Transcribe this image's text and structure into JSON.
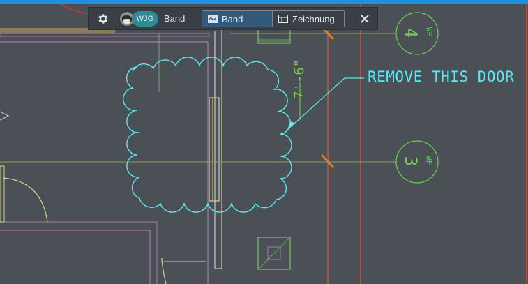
{
  "toolbar": {
    "title": "Band",
    "avatar_initials": "WJG",
    "modes": [
      {
        "label": "Band",
        "active": true
      },
      {
        "label": "Zeichnung",
        "active": false
      }
    ]
  },
  "drawing": {
    "annotation": "REMOVE THIS DOOR",
    "dimension_label": "7'-6\"",
    "grid_bubbles": [
      {
        "number": "4",
        "sub": "WF"
      },
      {
        "number": "3",
        "sub": "WF"
      }
    ]
  },
  "colors": {
    "accent_bar": "#1f8fe0",
    "toolbar_bg": "#3a3f45",
    "canvas_bg": "#4b4f56",
    "markup_cyan": "#5ce8f0",
    "dimension_green": "#7ccf4a",
    "grid_line_orange": "#d85a38",
    "wall_magenta": "#a37aa8",
    "door_yellow": "#d6d38a"
  },
  "icons": {
    "settings": "gear-icon",
    "close": "close-icon",
    "band_mode": "markup-band-icon",
    "drawing_mode": "drawing-sheet-icon"
  }
}
